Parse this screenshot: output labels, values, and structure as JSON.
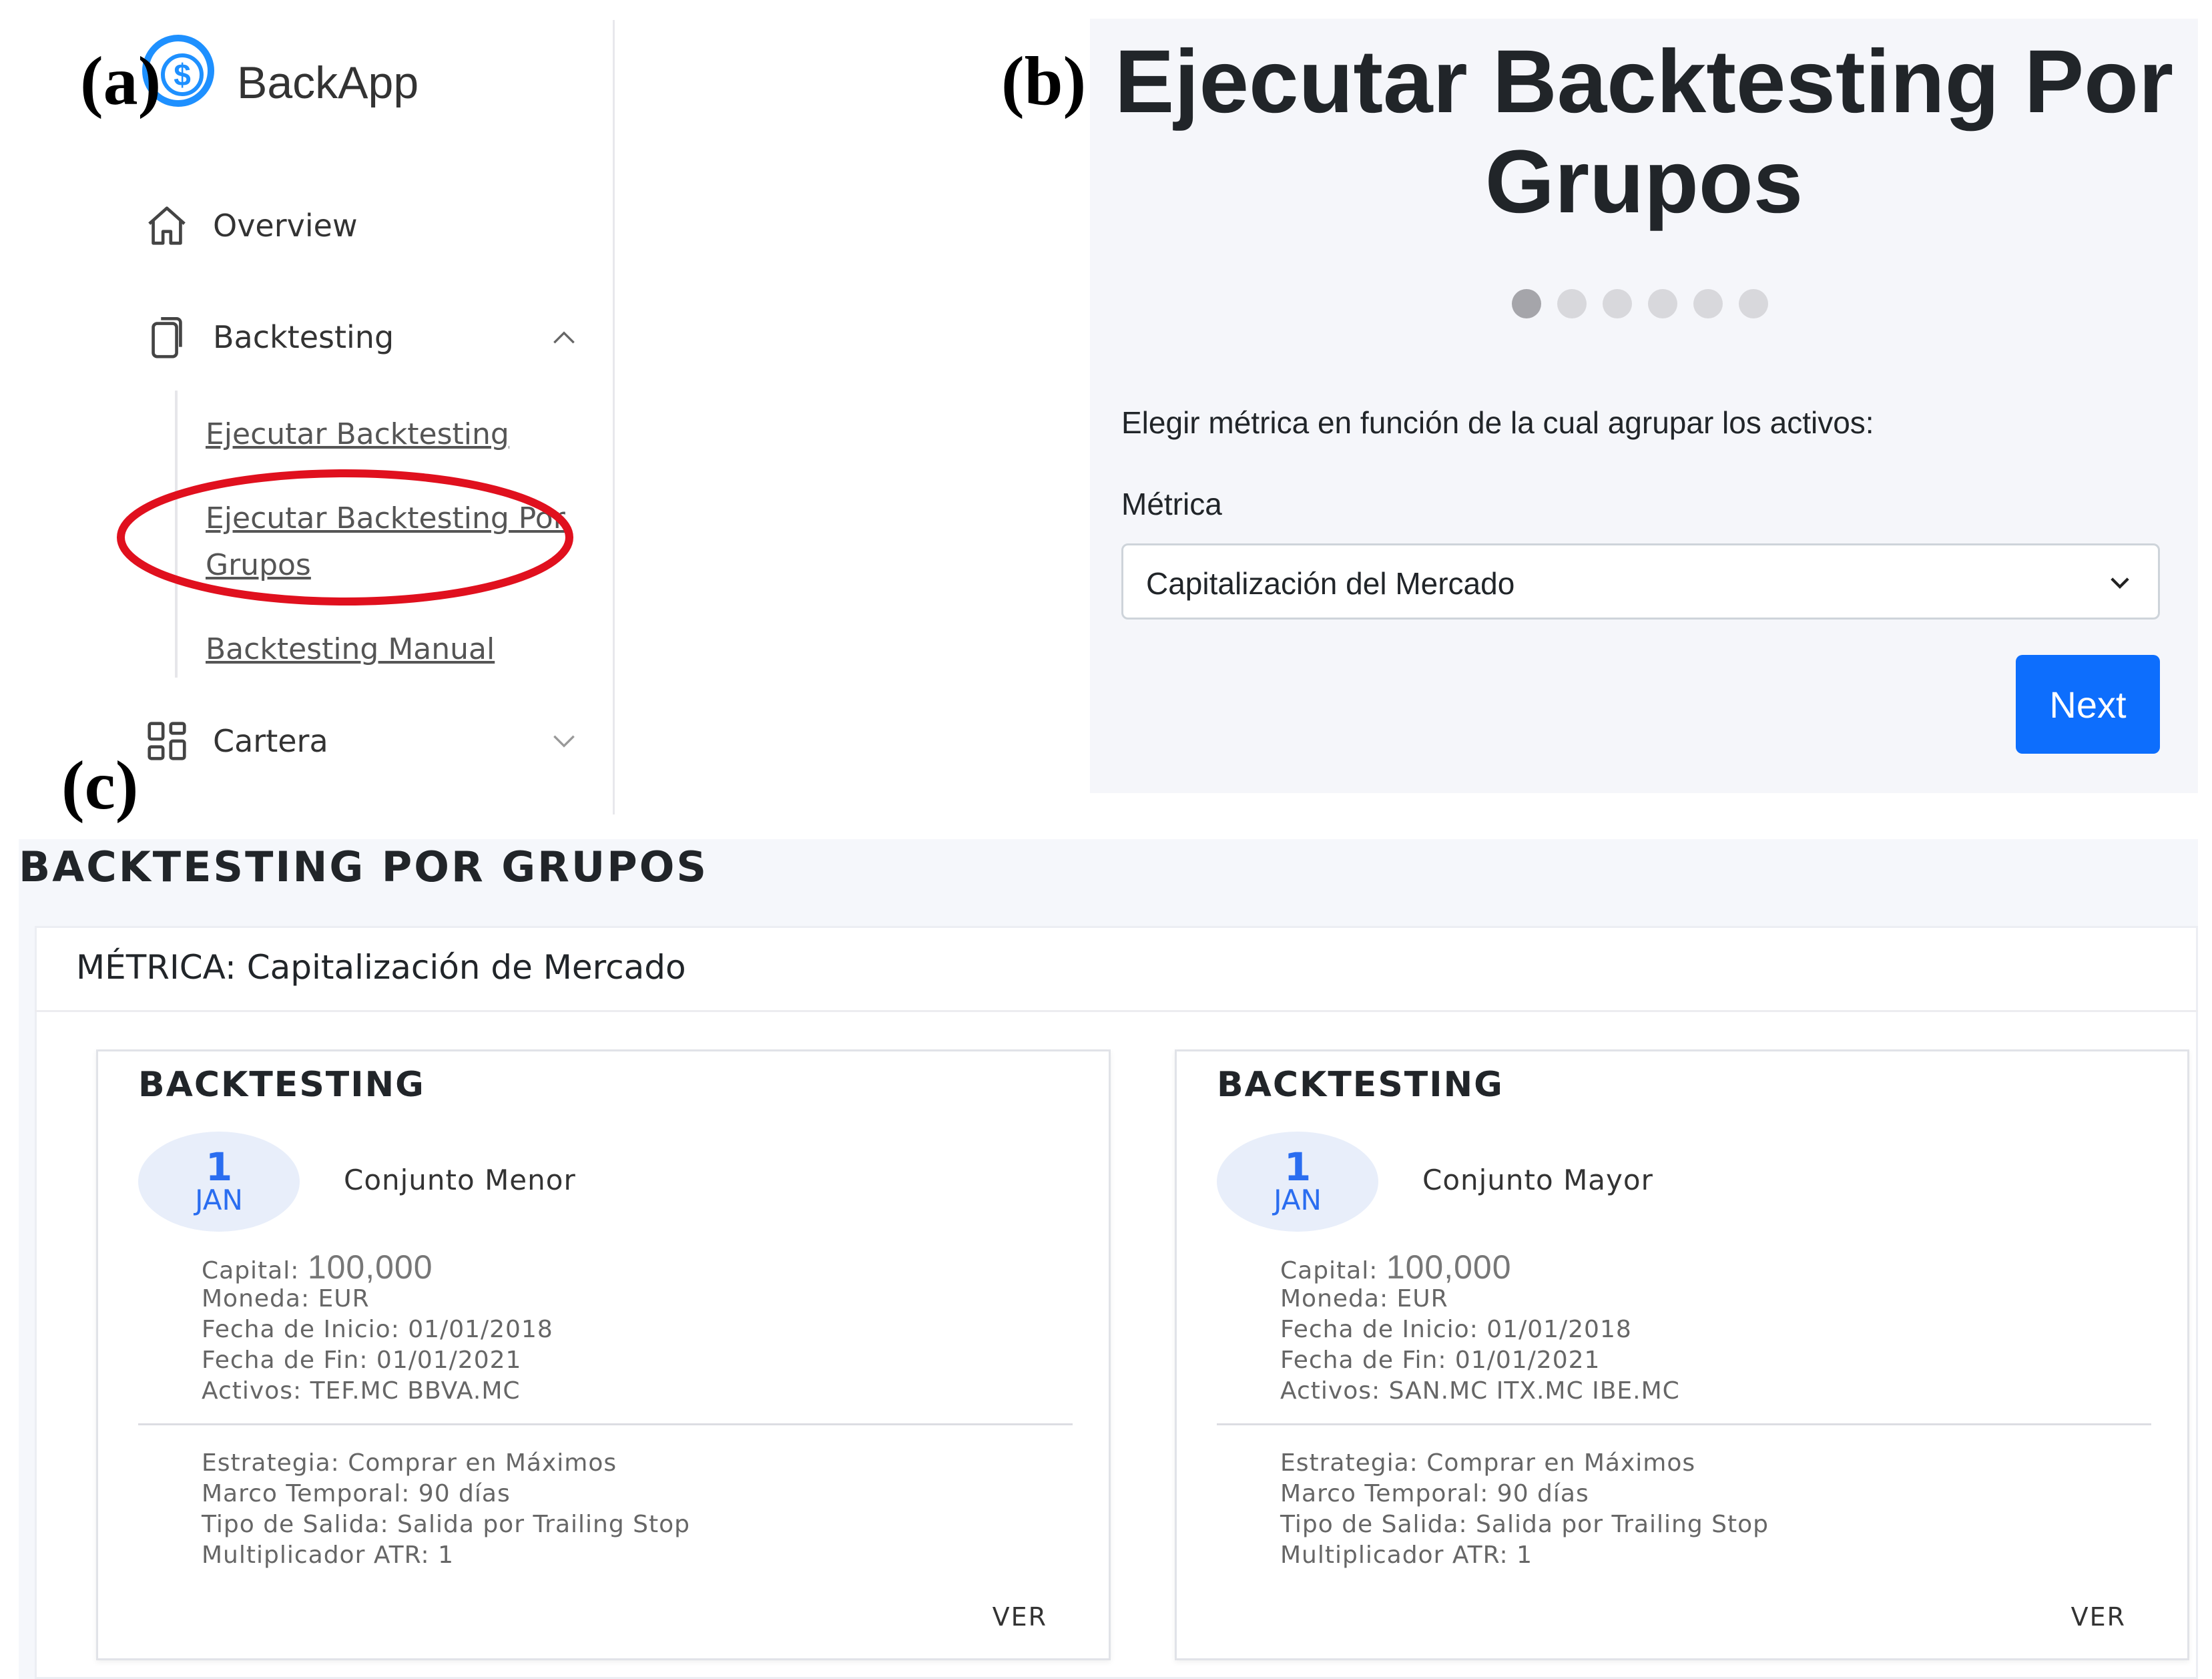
{
  "labels": {
    "a": "(a)",
    "b": "(b)",
    "c": "(c)"
  },
  "colors": {
    "accent": "#1e90ff",
    "primary_button": "#0d6efd",
    "highlight_ellipse": "#e0101e",
    "date_badge_text": "#2a6df0"
  },
  "sidebar": {
    "brand": "BackApp",
    "logo_glyph": "$",
    "items": [
      {
        "label": "Overview",
        "icon": "home-icon"
      },
      {
        "label": "Backtesting",
        "icon": "copy-icon",
        "expanded": true
      },
      {
        "label": "Cartera",
        "icon": "grid-icon",
        "expanded": false
      }
    ],
    "subitems": [
      "Ejecutar Backtesting",
      "Ejecutar Backtesting Por Grupos",
      "Backtesting Manual"
    ],
    "highlighted_subitem": "Ejecutar Backtesting Por Grupos"
  },
  "wizard": {
    "title": "Ejecutar Backtesting Por Grupos",
    "steps_total": 6,
    "current_step": 1,
    "prompt": "Elegir métrica en función de la cual agrupar los activos:",
    "field_label": "Métrica",
    "select_value": "Capitalización del Mercado",
    "next_label": "Next"
  },
  "results": {
    "heading": "BACKTESTING POR GRUPOS",
    "metric_line": "MÉTRICA: Capitalización de Mercado",
    "cards": [
      {
        "title": "BACKTESTING",
        "day": "1",
        "month": "JAN",
        "name": "Conjunto Menor",
        "capital_label": "Capital:",
        "capital_value": "100,000",
        "moneda": "Moneda: EUR",
        "inicio": "Fecha de Inicio: 01/01/2018",
        "fin": "Fecha de Fin: 01/01/2021",
        "activos": "Activos: TEF.MC BBVA.MC",
        "estrategia": "Estrategia: Comprar en Máximos",
        "marco": "Marco Temporal: 90 días",
        "salida": "Tipo de Salida: Salida por Trailing Stop",
        "atr": "Multiplicador ATR: 1",
        "ver": "VER"
      },
      {
        "title": "BACKTESTING",
        "day": "1",
        "month": "JAN",
        "name": "Conjunto Mayor",
        "capital_label": "Capital:",
        "capital_value": "100,000",
        "moneda": "Moneda: EUR",
        "inicio": "Fecha de Inicio: 01/01/2018",
        "fin": "Fecha de Fin: 01/01/2021",
        "activos": "Activos: SAN.MC ITX.MC IBE.MC",
        "estrategia": "Estrategia: Comprar en Máximos",
        "marco": "Marco Temporal: 90 días",
        "salida": "Tipo de Salida: Salida por Trailing Stop",
        "atr": "Multiplicador ATR: 1",
        "ver": "VER"
      }
    ]
  }
}
